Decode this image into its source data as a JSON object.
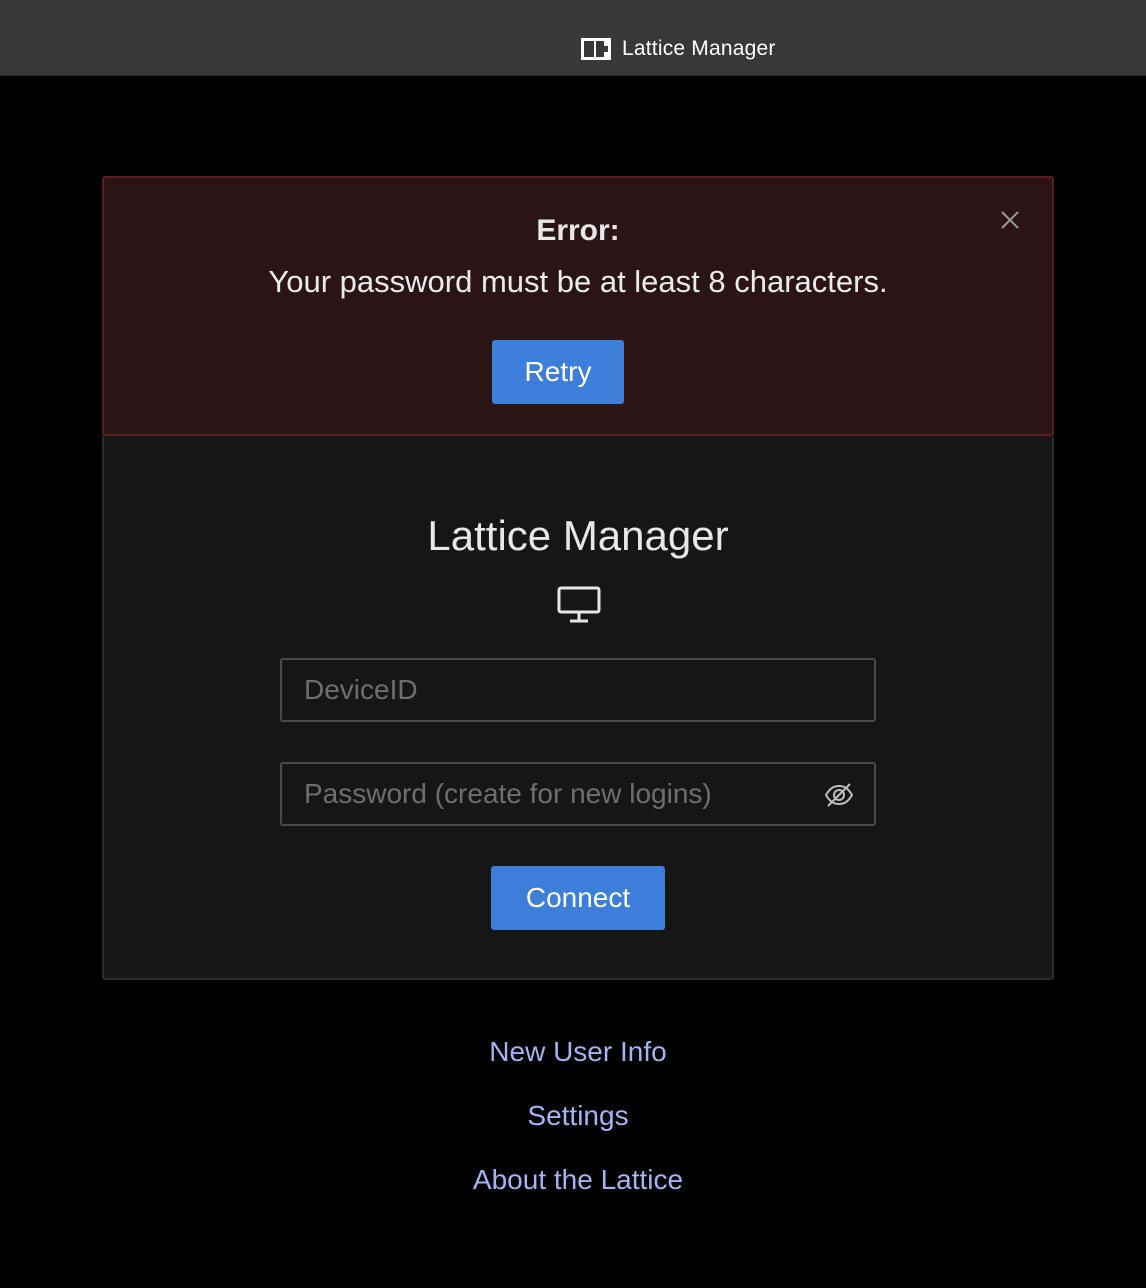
{
  "window": {
    "title": "Lattice Manager",
    "logo_icon": "lattice-logo-icon"
  },
  "error": {
    "title": "Error:",
    "message": "Your password must be at least 8 characters.",
    "retry_label": "Retry",
    "close_icon": "close-icon"
  },
  "login": {
    "title": "Lattice Manager",
    "device_icon": "monitor-icon",
    "device_id": {
      "value": "",
      "placeholder": "DeviceID"
    },
    "password": {
      "value": "",
      "placeholder": "Password (create for new logins)",
      "toggle_icon": "eye-off-icon"
    },
    "connect_label": "Connect"
  },
  "links": {
    "new_user": "New User Info",
    "settings": "Settings",
    "about": "About the Lattice"
  },
  "colors": {
    "accent": "#3c7ed9",
    "link": "#a3b4f4",
    "error_bg": "#2b1416",
    "error_border": "#5a1d21"
  }
}
